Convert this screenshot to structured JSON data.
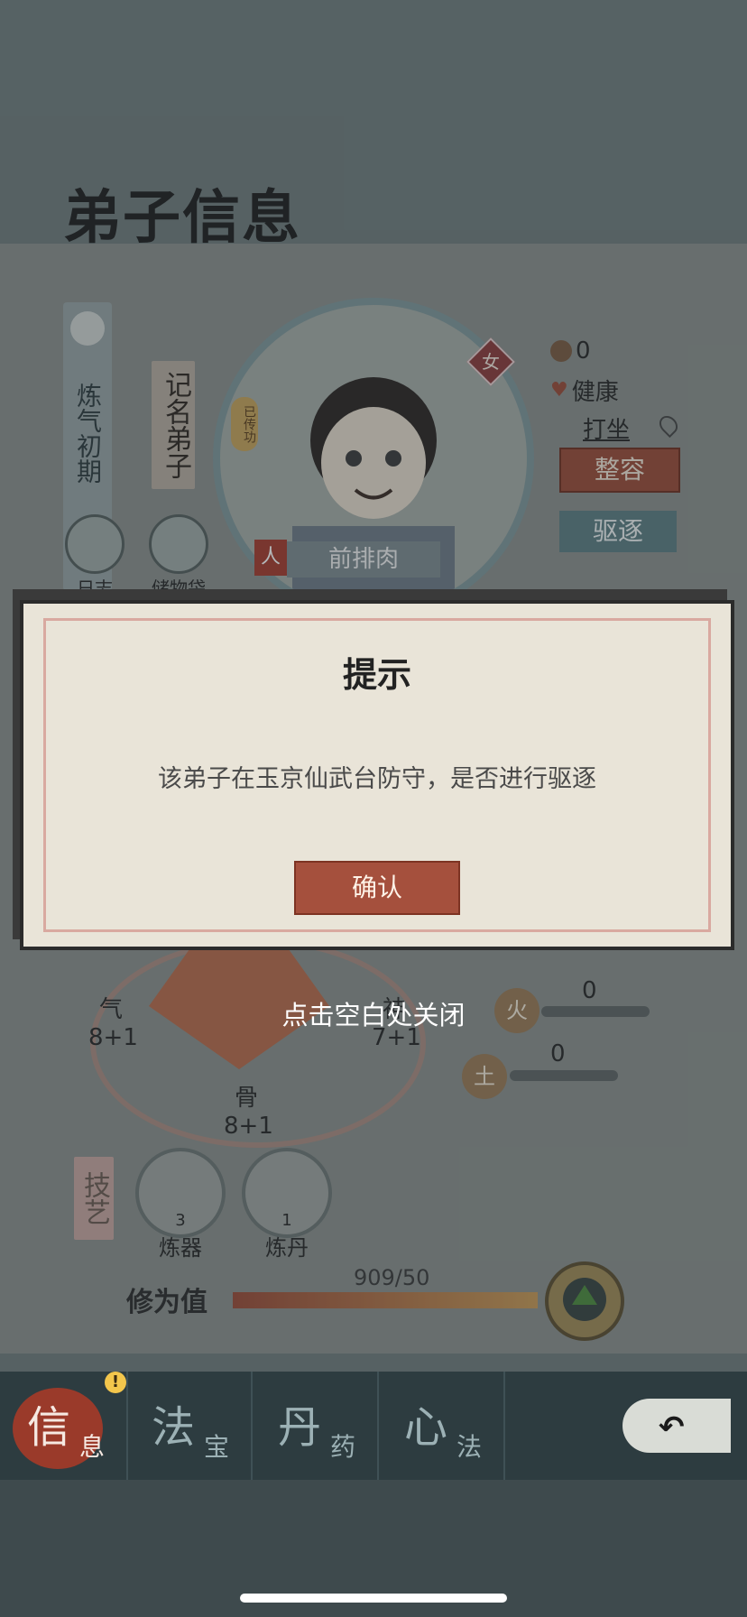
{
  "screen_title": "弟子信息",
  "disciple": {
    "realm": "炼气初期",
    "rank_tag": "记名弟子",
    "passed_on_tag": "已传功",
    "gender": "女",
    "name": "前排肉",
    "role_badge": "人",
    "spirit_count": "0",
    "health": "健康",
    "activity": "打坐"
  },
  "actions": {
    "makeover": "整容",
    "expel": "驱逐",
    "log": "日志",
    "storage_bag": "储物袋"
  },
  "attributes": {
    "qi_label": "气",
    "qi_value": "8+1",
    "right_value": "7+1",
    "right_label": "神",
    "bone_label": "骨",
    "bone_value": "8+1"
  },
  "elements": [
    {
      "icon": "火",
      "value": "0"
    },
    {
      "icon": "土",
      "value": "0"
    }
  ],
  "skills": {
    "section_label": "技艺",
    "items": [
      {
        "name": "炼器",
        "level": "3"
      },
      {
        "name": "炼丹",
        "level": "1"
      }
    ]
  },
  "cultivation": {
    "label": "修为值",
    "value": "909/50",
    "progress": 1.0
  },
  "dialog": {
    "title": "提示",
    "message": "该弟子在玉京仙武台防守，是否进行驱逐",
    "confirm": "确认"
  },
  "close_hint": "点击空白处关闭",
  "nav": [
    {
      "big": "信",
      "small": "息"
    },
    {
      "big": "法",
      "small": "宝"
    },
    {
      "big": "丹",
      "small": "药"
    },
    {
      "big": "心",
      "small": "法"
    }
  ],
  "nav_alert": "!",
  "colors": {
    "accent_red": "#a5503d",
    "teal": "#5b7d82",
    "nav_bg": "#2d3c40"
  }
}
